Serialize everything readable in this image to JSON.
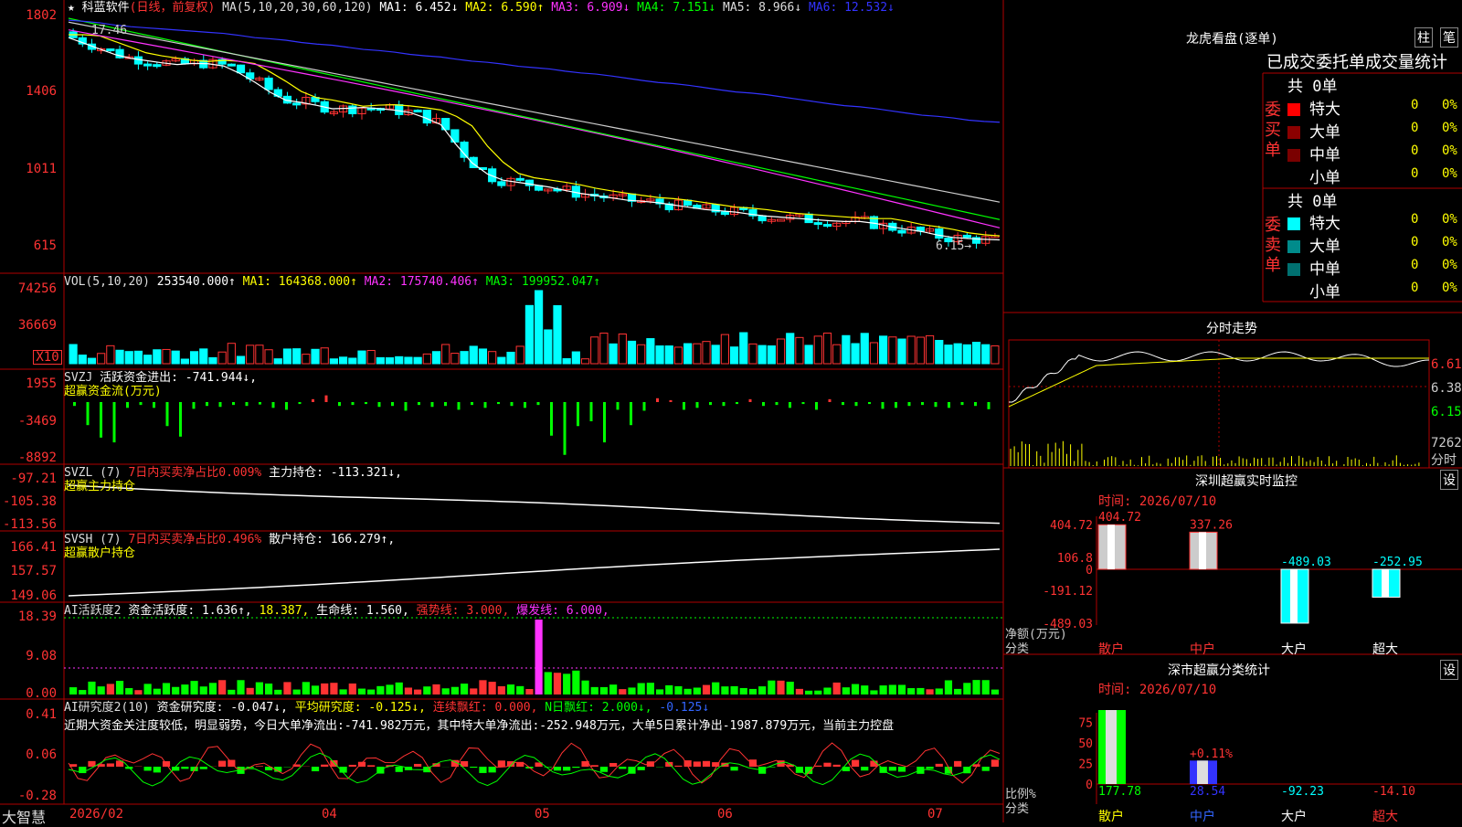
{
  "app": {
    "title": "大智慧",
    "axis_dates": [
      "2026/02",
      "04",
      "05",
      "06",
      "07"
    ]
  },
  "header": {
    "stock": "科蓝软件",
    "period": "(日线，前复权)",
    "ma_title": "MA(5,10,20,30,60,120)",
    "ma1": "MA1: 6.452↓",
    "ma2": "MA2: 6.590↑",
    "ma3": "MA3: 6.909↓",
    "ma4": "MA4: 7.151↓",
    "ma5": "MA5: 8.966↓",
    "ma6": "MA6: 12.532↓"
  },
  "price_panel": {
    "ticks": [
      "1802",
      "1406",
      "1011",
      "615"
    ],
    "high_label": "17.46",
    "low_label": "6.15→"
  },
  "vol_panel": {
    "title": "VOL(5,10,20)",
    "v": "253540.000↑",
    "ma1": "MA1: 164368.000↑",
    "ma2": "MA2: 175740.406↑",
    "ma3": "MA3: 199952.047↑",
    "ticks": [
      "74256",
      "36669"
    ],
    "unit": "X10"
  },
  "svzj": {
    "title": "SVZJ",
    "label": "活跃资金进出: -741.944↓,",
    "sub": "超赢资金流(万元)",
    "ticks": [
      "1955",
      "-3469",
      "-8892"
    ]
  },
  "svzl": {
    "title": "SVZL (7)",
    "label1": "7日内买卖净占比0.009%",
    "label2": "主力持仓: -113.321↓,",
    "sub": "超赢主力持仓",
    "ticks": [
      "-97.21",
      "-105.38",
      "-113.56"
    ]
  },
  "svsh": {
    "title": "SVSH (7)",
    "label1": "7日内买卖净占比0.496%",
    "label2": "散户持仓: 166.279↑,",
    "sub": "超赢散户持仓",
    "ticks": [
      "166.41",
      "157.57",
      "149.06"
    ]
  },
  "ai1": {
    "title": "AI活跃度2",
    "l1": "资金活跃度: 1.636↑,",
    "l2": "18.387,",
    "l3": "生命线: 1.560,",
    "l4": "强势线: 3.000,",
    "l5": "爆发线: 6.000,",
    "ticks": [
      "18.39",
      "9.08",
      "0.00"
    ]
  },
  "ai2": {
    "title": "AI研究度2(10)",
    "l1": "资金研究度: -0.047↓,",
    "l2": "平均研究度: -0.125↓,",
    "l3": "连续飘红: 0.000,",
    "l4": "N日飘红: 2.000↓,",
    "l5": "-0.125↓",
    "comment": "近期大资金关注度较低，明显弱势，今日大单净流出:-741.982万元，其中特大单净流出:-252.948万元，大单5日累计净出-1987.879万元，当前主力控盘",
    "ticks": [
      "0.41",
      "0.06",
      "-0.28"
    ]
  },
  "lhb": {
    "title": "龙虎看盘(逐单)",
    "btn1": "柱",
    "btn2": "笔",
    "tabs": [
      "已成交",
      "委托单",
      "成交量",
      "统计"
    ],
    "buy_label": "委买单",
    "sell_label": "委卖单",
    "buy_total": "共 0单",
    "sell_total": "共 0单",
    "buy_rows": [
      {
        "name": "特大",
        "n": "0",
        "p": "0%"
      },
      {
        "name": "大单",
        "n": "0",
        "p": "0%"
      },
      {
        "name": "中单",
        "n": "0",
        "p": "0%"
      },
      {
        "name": "小单",
        "n": "0",
        "p": "0%"
      }
    ],
    "sell_rows": [
      {
        "name": "特大",
        "n": "0",
        "p": "0%"
      },
      {
        "name": "大单",
        "n": "0",
        "p": "0%"
      },
      {
        "name": "中单",
        "n": "0",
        "p": "0%"
      },
      {
        "name": "小单",
        "n": "0",
        "p": "0%"
      }
    ]
  },
  "fenshi": {
    "title": "分时走势",
    "ticks": [
      "6.61",
      "6.38",
      "6.15"
    ],
    "vol_tick": "7262",
    "unit": "分时"
  },
  "monitor": {
    "title": "深圳超赢实时监控",
    "btn": "设",
    "time": "时间: 2026/07/10",
    "ticks": [
      "404.72",
      "106.8",
      "0",
      "-191.12",
      "-489.03"
    ],
    "unit": "净额(万元)",
    "cat_label": "分类",
    "cats": [
      "散户",
      "中户",
      "大户",
      "超大"
    ],
    "values": [
      404.72,
      337.26,
      -489.03,
      -252.95
    ],
    "value_labels": [
      "404.72",
      "337.26",
      "-489.03",
      "-252.95"
    ]
  },
  "classify": {
    "title": "深市超赢分类统计",
    "btn": "设",
    "time": "时间: 2026/07/10",
    "ticks": [
      "75",
      "50",
      "25",
      "0"
    ],
    "unit": "比例%",
    "cat_label": "分类",
    "cats": [
      "散户",
      "中户",
      "大户",
      "超大"
    ],
    "values": [
      177.78,
      28.54,
      -92.23,
      -14.1
    ],
    "value_labels": [
      "177.78",
      "28.54",
      "-92.23",
      "-14.10"
    ],
    "note": "+0.11%"
  },
  "chart_data": [
    {
      "type": "line",
      "title": "科蓝软件 日线 MA",
      "series": [
        {
          "name": "MA1",
          "values": [
            16.9,
            16.4,
            15.9,
            15.7,
            15.5,
            15.6,
            15.4,
            14.6,
            13.7,
            13.5,
            13.2,
            13.3,
            13.2,
            13.0,
            12.4,
            10.6,
            9.6,
            9.4,
            9.2,
            8.9,
            8.7,
            8.5,
            8.4,
            8.2,
            8.0,
            7.9,
            7.7,
            7.6,
            7.5,
            7.4,
            7.4,
            7.1,
            6.9,
            6.6,
            6.5,
            6.45
          ]
        },
        {
          "name": "MA6",
          "values": [
            17.8,
            17.7,
            17.5,
            17.4,
            17.3,
            17.2,
            17.1,
            16.9,
            16.8,
            16.6,
            16.5,
            16.3,
            16.2,
            16.0,
            15.9,
            15.7,
            15.6,
            15.4,
            15.3,
            15.1,
            15.0,
            14.8,
            14.6,
            14.5,
            14.3,
            14.1,
            14.0,
            13.8,
            13.6,
            13.4,
            13.3,
            13.1,
            12.9,
            12.8,
            12.6,
            12.53
          ]
        }
      ]
    },
    {
      "type": "bar",
      "title": "SVZJ 活跃资金进出",
      "values": [
        -400,
        -2400,
        -3700,
        -4200,
        -600,
        -300,
        -600,
        -2500,
        -3600,
        -700,
        -400,
        -500,
        -300,
        -400,
        -250,
        -600,
        -800,
        -200,
        300,
        700,
        -400,
        -300,
        -200,
        -500,
        -400,
        -900,
        -300,
        -500,
        -400,
        -800,
        -300,
        -600,
        -200,
        -400,
        -600,
        -300,
        -3500,
        -5500,
        -2500,
        -2000,
        -4200,
        -800,
        -2400,
        -900,
        400,
        200,
        -800,
        -600,
        -300,
        -400,
        -200,
        300,
        -400,
        -300,
        -600,
        -200,
        -800,
        300,
        -300,
        -400,
        -200,
        -700,
        -600,
        -400,
        -300,
        -500,
        -600,
        -300,
        -400,
        -741.9
      ]
    },
    {
      "type": "bar",
      "title": "深圳超赢实时监控",
      "categories": [
        "散户",
        "中户",
        "大户",
        "超大"
      ],
      "values": [
        404.72,
        337.26,
        -489.03,
        -252.95
      ]
    },
    {
      "type": "bar",
      "title": "深市超赢分类统计",
      "categories": [
        "散户",
        "中户",
        "大户",
        "超大"
      ],
      "values": [
        177.78,
        28.54,
        -92.23,
        -14.1
      ]
    }
  ]
}
